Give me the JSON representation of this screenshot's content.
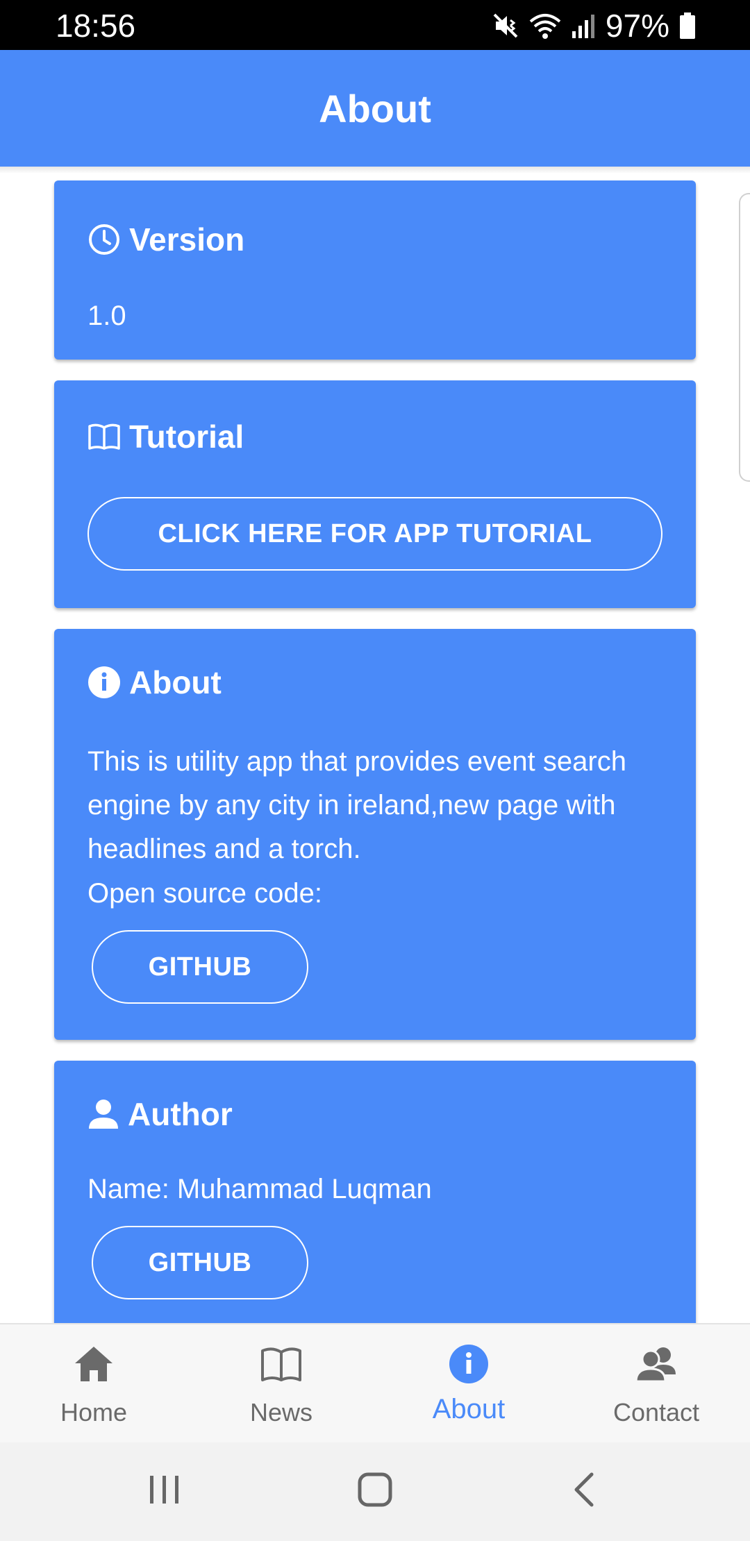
{
  "status": {
    "time": "18:56",
    "battery": "97%"
  },
  "header": {
    "title": "About"
  },
  "cards": {
    "version": {
      "title": "Version",
      "value": "1.0"
    },
    "tutorial": {
      "title": "Tutorial",
      "button": "CLICK HERE FOR APP TUTORIAL"
    },
    "about": {
      "title": "About",
      "description": "This is utility app that provides event search engine by any city in ireland,new page with headlines and a torch.",
      "source_label": "Open source code:",
      "button": "GITHUB"
    },
    "author": {
      "title": "Author",
      "name": "Name: Muhammad Luqman",
      "button": "GITHUB"
    }
  },
  "nav": {
    "items": [
      {
        "label": "Home",
        "icon": "home-icon"
      },
      {
        "label": "News",
        "icon": "book-icon"
      },
      {
        "label": "About",
        "icon": "info-icon",
        "active": true
      },
      {
        "label": "Contact",
        "icon": "contacts-icon"
      }
    ]
  },
  "colors": {
    "accent": "#4a8af9",
    "nav_inactive": "#6a6a6a",
    "nav_bg": "#f7f7f7"
  }
}
